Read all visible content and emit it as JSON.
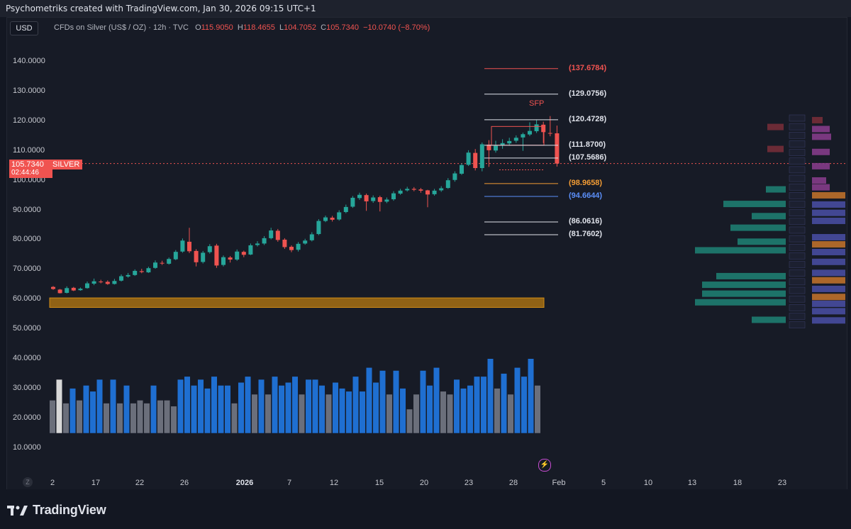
{
  "header": {
    "credit": "Psychometriks created with TradingView.com, Jan 30, 2026 09:15 UTC+1"
  },
  "toolbar": {
    "currency_button": "USD"
  },
  "legend": {
    "symbol_desc": "CFDs on Silver (US$ / OZ) · 12h · TVC",
    "o_label": "O",
    "o_value": "115.9050",
    "h_label": "H",
    "h_value": "118.4655",
    "l_label": "L",
    "l_value": "104.7052",
    "c_label": "C",
    "c_value": "105.7340",
    "change": "−10.0740 (−8.70%)"
  },
  "price_tag": {
    "price": "105.7340",
    "countdown": "02:44:46",
    "symbol": "SILVER"
  },
  "colors": {
    "up": "#26a69a",
    "down": "#ef5350",
    "vol_blue": "#1f6fd1",
    "vol_gray": "#6b6f7b",
    "zone": "#b97b10",
    "purple": "#c74dd2"
  },
  "annotations": {
    "sfp": "SFP",
    "levels": [
      {
        "text": "(137.6784)",
        "value": 137.6784,
        "color": "#ef5350"
      },
      {
        "text": "(129.0756)",
        "value": 129.0756,
        "color": "#e0e3eb"
      },
      {
        "text": "(120.4728)",
        "value": 120.4728,
        "color": "#e0e3eb"
      },
      {
        "text": "(111.8700)",
        "value": 111.87,
        "color": "#e0e3eb"
      },
      {
        "text": "(107.5686)",
        "value": 107.5686,
        "color": "#e0e3eb"
      },
      {
        "text": "(98.9658)",
        "value": 98.9658,
        "color": "#f39c34"
      },
      {
        "text": "(94.6644)",
        "value": 94.6644,
        "color": "#5b8ff9"
      },
      {
        "text": "(86.0616)",
        "value": 86.0616,
        "color": "#e0e3eb"
      },
      {
        "text": "(81.7602)",
        "value": 81.7602,
        "color": "#e0e3eb"
      }
    ]
  },
  "footer": {
    "brand": "TradingView",
    "bolt_icon": "lightning-icon"
  },
  "chart_data": {
    "type": "candlestick",
    "title": "CFDs on Silver (US$ / OZ) · 12h · TVC",
    "ylim": [
      7,
      148
    ],
    "y_ticks": [
      "140.0000",
      "130.0000",
      "120.0000",
      "110.0000",
      "100.0000",
      "90.0000",
      "80.0000",
      "70.0000",
      "60.0000",
      "50.0000",
      "40.0000",
      "30.0000",
      "20.0000",
      "10.0000"
    ],
    "y_tick_values": [
      140,
      130,
      120,
      110,
      100,
      90,
      80,
      70,
      60,
      50,
      40,
      30,
      20,
      10
    ],
    "x_ticks": [
      "2",
      "17",
      "22",
      "26",
      "2026",
      "7",
      "12",
      "15",
      "20",
      "23",
      "28",
      "Feb",
      "5",
      "10",
      "13",
      "18",
      "23"
    ],
    "candles": [
      [
        64.2,
        63.5,
        64.5,
        63.2
      ],
      [
        63.3,
        62.1,
        63.5,
        62.0
      ],
      [
        62.2,
        63.8,
        64.4,
        62.0
      ],
      [
        63.9,
        63.0,
        64.2,
        62.8
      ],
      [
        63.1,
        63.6,
        64.0,
        62.9
      ],
      [
        63.8,
        65.4,
        66.0,
        63.6
      ],
      [
        65.3,
        66.1,
        67.0,
        64.8
      ],
      [
        66.0,
        65.8,
        66.6,
        65.4
      ],
      [
        65.9,
        65.2,
        66.4,
        64.9
      ],
      [
        65.2,
        66.2,
        66.9,
        65.0
      ],
      [
        66.3,
        67.8,
        68.4,
        66.0
      ],
      [
        67.7,
        68.2,
        68.9,
        67.3
      ],
      [
        68.2,
        69.6,
        70.1,
        67.9
      ],
      [
        69.5,
        69.2,
        70.3,
        68.8
      ],
      [
        69.1,
        70.5,
        71.0,
        68.9
      ],
      [
        70.6,
        72.4,
        73.1,
        70.3
      ],
      [
        72.3,
        72.1,
        73.0,
        71.6
      ],
      [
        72.0,
        73.6,
        74.1,
        71.7
      ],
      [
        73.5,
        76.0,
        76.6,
        73.2
      ],
      [
        76.1,
        79.8,
        80.5,
        75.7
      ],
      [
        79.4,
        76.2,
        84.1,
        75.6
      ],
      [
        76.3,
        72.5,
        76.9,
        71.1
      ],
      [
        72.6,
        75.7,
        76.3,
        72.1
      ],
      [
        75.9,
        77.9,
        78.6,
        75.4
      ],
      [
        78.1,
        71.4,
        78.7,
        70.6
      ],
      [
        71.6,
        74.2,
        74.8,
        71.1
      ],
      [
        74.1,
        73.4,
        74.6,
        72.4
      ],
      [
        73.4,
        76.1,
        76.8,
        73.0
      ],
      [
        76.0,
        75.0,
        76.4,
        74.2
      ],
      [
        75.1,
        78.2,
        78.8,
        74.9
      ],
      [
        78.3,
        78.8,
        79.6,
        77.8
      ],
      [
        78.8,
        80.6,
        81.3,
        78.3
      ],
      [
        80.6,
        83.2,
        84.1,
        80.2
      ],
      [
        83.1,
        80.0,
        83.7,
        79.4
      ],
      [
        80.1,
        77.6,
        80.6,
        77.0
      ],
      [
        77.7,
        76.6,
        78.2,
        75.9
      ],
      [
        76.7,
        78.7,
        79.3,
        76.1
      ],
      [
        78.8,
        79.8,
        80.4,
        78.4
      ],
      [
        79.9,
        81.9,
        82.6,
        79.5
      ],
      [
        82.0,
        86.4,
        87.0,
        81.6
      ],
      [
        86.4,
        87.6,
        88.2,
        86.0
      ],
      [
        87.5,
        86.8,
        88.1,
        86.2
      ],
      [
        86.9,
        89.3,
        90.0,
        86.5
      ],
      [
        89.4,
        91.1,
        91.9,
        89.0
      ],
      [
        91.2,
        94.2,
        94.8,
        90.8
      ],
      [
        94.1,
        95.2,
        95.9,
        93.5
      ],
      [
        95.1,
        93.0,
        95.6,
        89.8
      ],
      [
        93.1,
        94.3,
        95.0,
        92.5
      ],
      [
        94.4,
        92.8,
        94.9,
        89.6
      ],
      [
        92.9,
        93.6,
        94.3,
        92.4
      ],
      [
        93.7,
        95.7,
        96.4,
        93.2
      ],
      [
        95.6,
        96.6,
        97.2,
        95.2
      ],
      [
        96.7,
        97.2,
        97.9,
        96.3
      ],
      [
        97.2,
        96.9,
        97.8,
        96.4
      ],
      [
        97.0,
        96.6,
        97.5,
        95.9
      ],
      [
        96.7,
        95.3,
        96.9,
        91.0
      ],
      [
        95.4,
        96.6,
        97.2,
        94.9
      ],
      [
        96.7,
        97.4,
        98.1,
        96.2
      ],
      [
        97.5,
        100.1,
        100.8,
        97.2
      ],
      [
        100.2,
        102.4,
        103.1,
        99.6
      ],
      [
        102.3,
        105.2,
        105.8,
        101.9
      ],
      [
        105.3,
        109.4,
        110.2,
        104.9
      ],
      [
        109.3,
        104.2,
        110.6,
        103.4
      ],
      [
        104.2,
        112.2,
        112.8,
        103.1
      ],
      [
        112.1,
        110.2,
        113.6,
        104.6
      ],
      [
        110.1,
        111.7,
        113.4,
        109.4
      ],
      [
        111.8,
        112.6,
        113.9,
        110.7
      ],
      [
        112.5,
        113.3,
        114.4,
        111.7
      ],
      [
        113.4,
        114.4,
        115.2,
        112.7
      ],
      [
        114.5,
        115.6,
        116.1,
        110.0
      ],
      [
        115.5,
        116.7,
        119.6,
        115.0
      ],
      [
        116.6,
        118.9,
        120.4,
        116.0
      ],
      [
        118.8,
        116.3,
        119.8,
        112.6
      ],
      [
        116.0,
        115.9,
        121.7,
        114.9
      ],
      [
        115.9,
        105.7,
        118.5,
        104.7
      ]
    ],
    "volume": [
      [
        26,
        "g"
      ],
      [
        33,
        "w"
      ],
      [
        25,
        "g"
      ],
      [
        30,
        "b"
      ],
      [
        26,
        "g"
      ],
      [
        31,
        "b"
      ],
      [
        29,
        "b"
      ],
      [
        33,
        "b"
      ],
      [
        25,
        "g"
      ],
      [
        33,
        "b"
      ],
      [
        25,
        "g"
      ],
      [
        31,
        "b"
      ],
      [
        25,
        "g"
      ],
      [
        26,
        "g"
      ],
      [
        25,
        "g"
      ],
      [
        31,
        "b"
      ],
      [
        26,
        "g"
      ],
      [
        26,
        "g"
      ],
      [
        24,
        "g"
      ],
      [
        33,
        "b"
      ],
      [
        34,
        "b"
      ],
      [
        31,
        "b"
      ],
      [
        33,
        "b"
      ],
      [
        30,
        "b"
      ],
      [
        34,
        "b"
      ],
      [
        31,
        "b"
      ],
      [
        31,
        "b"
      ],
      [
        25,
        "g"
      ],
      [
        32,
        "b"
      ],
      [
        34,
        "b"
      ],
      [
        28,
        "g"
      ],
      [
        33,
        "b"
      ],
      [
        28,
        "g"
      ],
      [
        34,
        "b"
      ],
      [
        31,
        "b"
      ],
      [
        32,
        "b"
      ],
      [
        34,
        "b"
      ],
      [
        28,
        "g"
      ],
      [
        33,
        "b"
      ],
      [
        33,
        "b"
      ],
      [
        31,
        "b"
      ],
      [
        28,
        "g"
      ],
      [
        32,
        "b"
      ],
      [
        30,
        "b"
      ],
      [
        29,
        "b"
      ],
      [
        34,
        "b"
      ],
      [
        29,
        "b"
      ],
      [
        37,
        "b"
      ],
      [
        32,
        "b"
      ],
      [
        36,
        "b"
      ],
      [
        28,
        "g"
      ],
      [
        36,
        "b"
      ],
      [
        30,
        "b"
      ],
      [
        23,
        "g"
      ],
      [
        28,
        "g"
      ],
      [
        36,
        "b"
      ],
      [
        31,
        "b"
      ],
      [
        37,
        "b"
      ],
      [
        29,
        "g"
      ],
      [
        28,
        "g"
      ],
      [
        33,
        "b"
      ],
      [
        30,
        "b"
      ],
      [
        31,
        "b"
      ],
      [
        34,
        "b"
      ],
      [
        34,
        "b"
      ],
      [
        40,
        "b"
      ],
      [
        30,
        "g"
      ],
      [
        35,
        "b"
      ],
      [
        28,
        "g"
      ],
      [
        37,
        "b"
      ],
      [
        34,
        "b"
      ],
      [
        40,
        "b"
      ],
      [
        31,
        "g"
      ]
    ],
    "zone": {
      "label": "",
      "low": 57.3,
      "high": 60.5
    },
    "current_price": 105.734
  }
}
